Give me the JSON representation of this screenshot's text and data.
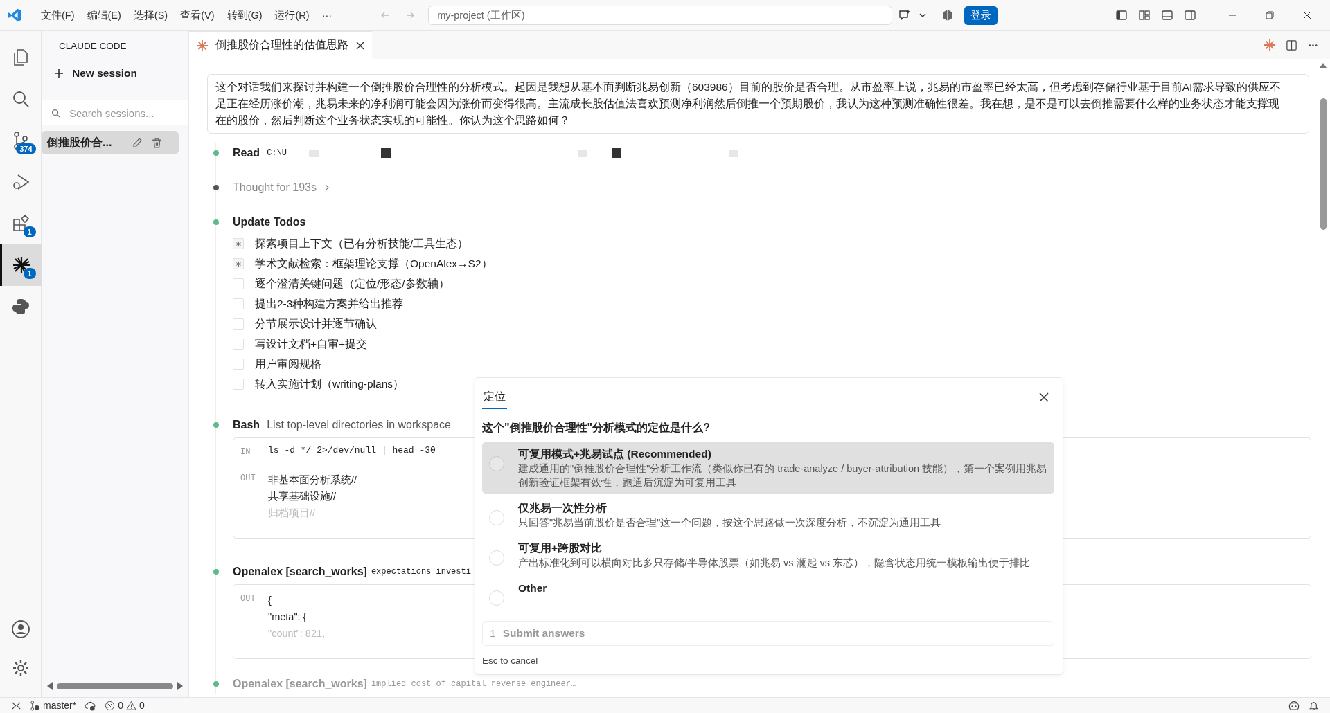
{
  "titlebar": {
    "menus": [
      "文件(F)",
      "编辑(E)",
      "选择(S)",
      "查看(V)",
      "转到(G)",
      "运行(R)",
      "···"
    ],
    "search": "my-project (工作区)",
    "login": "登录"
  },
  "activity_bar": [
    {
      "selected": false
    },
    {
      "selected": false
    },
    {
      "badge": "374",
      "selected": false
    },
    {
      "selected": false
    },
    {
      "badge": "1",
      "selected": false
    },
    {
      "badge": "1",
      "selected": true
    },
    {
      "selected": false
    }
  ],
  "sidebar": {
    "title": "CLAUDE CODE",
    "new_session": "New session",
    "search_placeholder": "Search sessions...",
    "sessions": [
      {
        "label": "倒推股价合...",
        "selected": true
      }
    ]
  },
  "tab": {
    "title": "倒推股价合理性的估值思路"
  },
  "message": "这个对话我们来探讨并构建一个倒推股价合理性的分析模式。起因是我想从基本面判断兆易创新（603986）目前的股价是否合理。从市盈率上说，兆易的市盈率已经太高，但考虑到存储行业基于目前AI需求导致的供应不足正在经历涨价潮，兆易未来的净利润可能会因为涨价而变得很高。主流成长股估值法喜欢预测净利润然后倒推一个预期股价，我认为这种预测准确性很差。我在想，是不是可以去倒推需要什么样的业务状态才能支撑现在的股价，然后判断这个业务状态实现的可能性。你认为这个思路如何？",
  "timeline": [
    {
      "kind": "read",
      "color": "#5fb98f",
      "title": "Read",
      "detail": "C:\\U",
      "faded": false
    },
    {
      "kind": "thought",
      "color": "#555555",
      "title": "Thought for 193s",
      "faded": false
    },
    {
      "kind": "todos",
      "color": "#5fb98f",
      "title": "Update Todos",
      "faded": false,
      "todos": [
        {
          "text": "探索项目上下文（已有分析技能/工具生态）",
          "in_progress": true
        },
        {
          "text": "学术文献检索：框架理论支撑（OpenAlex→S2）",
          "in_progress": true
        },
        {
          "text": "逐个澄清关键问题（定位/形态/参数轴）",
          "in_progress": false
        },
        {
          "text": "提出2-3种构建方案并给出推荐",
          "in_progress": false
        },
        {
          "text": "分节展示设计并逐节确认",
          "in_progress": false
        },
        {
          "text": "写设计文档+自审+提交",
          "in_progress": false
        },
        {
          "text": "用户审阅规格",
          "in_progress": false
        },
        {
          "text": "转入实施计划（writing-plans）",
          "in_progress": false
        }
      ]
    },
    {
      "kind": "tool",
      "color": "#5fb98f",
      "title": "Bash",
      "detail": "List top-level directories in workspace",
      "faded": false,
      "in_label": "IN",
      "input": "ls -d */ 2>/dev/null | head -30",
      "out_label": "OUT",
      "output": [
        "非基本面分析系统//",
        "共享基础设施//",
        "归档项目//"
      ]
    },
    {
      "kind": "tool",
      "color": "#5fb98f",
      "title": "Openalex [search_works]",
      "code": "expectations investi",
      "faded": false,
      "out_label": "OUT",
      "output": [
        "{",
        "\"meta\": {",
        "\"count\": 821,"
      ]
    },
    {
      "kind": "tool",
      "color": "#5fb98f",
      "title": "Openalex [search_works]",
      "code": "implied cost of capital reverse engineer…",
      "faded": true
    }
  ],
  "dialog": {
    "tabs": [
      {
        "label": "定位",
        "selected": true
      }
    ],
    "question": "这个\"倒推股价合理性\"分析模式的定位是什么?",
    "options": [
      {
        "title": "可复用模式+兆易试点 (Recommended)",
        "description": "建成通用的\"倒推股价合理性\"分析工作流（类似你已有的 trade-analyze / buyer-attribution 技能），第一个案例用兆易创新验证框架有效性，跑通后沉淀为可复用工具",
        "selected": true
      },
      {
        "title": "仅兆易一次性分析",
        "description": "只回答\"兆易当前股价是否合理\"这一个问题，按这个思路做一次深度分析，不沉淀为通用工具",
        "selected": false
      },
      {
        "title": "可复用+跨股对比",
        "description": "产出标准化到可以横向对比多只存储/半导体股票（如兆易 vs 澜起 vs 东芯），隐含状态用统一模板输出便于排比",
        "selected": false
      },
      {
        "title": "Other",
        "selected": false
      }
    ],
    "submit_number": "1",
    "submit": "Submit answers",
    "hint": "Esc to cancel"
  },
  "status_bar": {
    "branch": "master*",
    "errors": "0",
    "warnings": "0"
  }
}
